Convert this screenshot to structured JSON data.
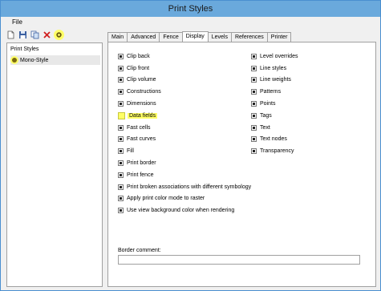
{
  "window": {
    "title": "Print Styles"
  },
  "menubar": {
    "file": "File"
  },
  "toolbar": {
    "icons": [
      "new-document-icon",
      "save-icon",
      "copy-icon",
      "delete-icon",
      "active-style-icon"
    ]
  },
  "left_pane": {
    "header": "Print Styles",
    "items": [
      {
        "label": "Mono-Style",
        "icon": "style-icon"
      }
    ]
  },
  "tabs": [
    {
      "label": "Main",
      "active": false
    },
    {
      "label": "Advanced",
      "active": false
    },
    {
      "label": "Fence",
      "active": false
    },
    {
      "label": "Display",
      "active": true
    },
    {
      "label": "Levels",
      "active": false
    },
    {
      "label": "References",
      "active": false
    },
    {
      "label": "Printer",
      "active": false
    }
  ],
  "display_options": {
    "left": [
      {
        "label": "Clip back",
        "checked": true
      },
      {
        "label": "Clip front",
        "checked": true
      },
      {
        "label": "Clip volume",
        "checked": true
      },
      {
        "label": "Constructions",
        "checked": true
      },
      {
        "label": "Dimensions",
        "checked": true
      },
      {
        "label": "Data fields",
        "checked": false,
        "highlighted": true
      },
      {
        "label": "Fast cells",
        "checked": true
      },
      {
        "label": "Fast curves",
        "checked": true
      },
      {
        "label": "Fill",
        "checked": true
      },
      {
        "label": "Print border",
        "checked": true
      },
      {
        "label": "Print fence",
        "checked": true
      },
      {
        "label": "Print broken associations with different symbology",
        "checked": true
      },
      {
        "label": "Apply print color mode to raster",
        "checked": true
      },
      {
        "label": "Use view background color when rendering",
        "checked": true
      }
    ],
    "right": [
      {
        "label": "Level overrides",
        "checked": true
      },
      {
        "label": "Line styles",
        "checked": true
      },
      {
        "label": "Line weights",
        "checked": true
      },
      {
        "label": "Patterns",
        "checked": true
      },
      {
        "label": "Points",
        "checked": true
      },
      {
        "label": "Tags",
        "checked": true
      },
      {
        "label": "Text",
        "checked": true
      },
      {
        "label": "Text nodes",
        "checked": true
      },
      {
        "label": "Transparency",
        "checked": true
      }
    ]
  },
  "border_comment": {
    "label": "Border comment:",
    "value": ""
  },
  "colors": {
    "titlebar": "#6aa9dc",
    "highlight": "#ffff66"
  }
}
